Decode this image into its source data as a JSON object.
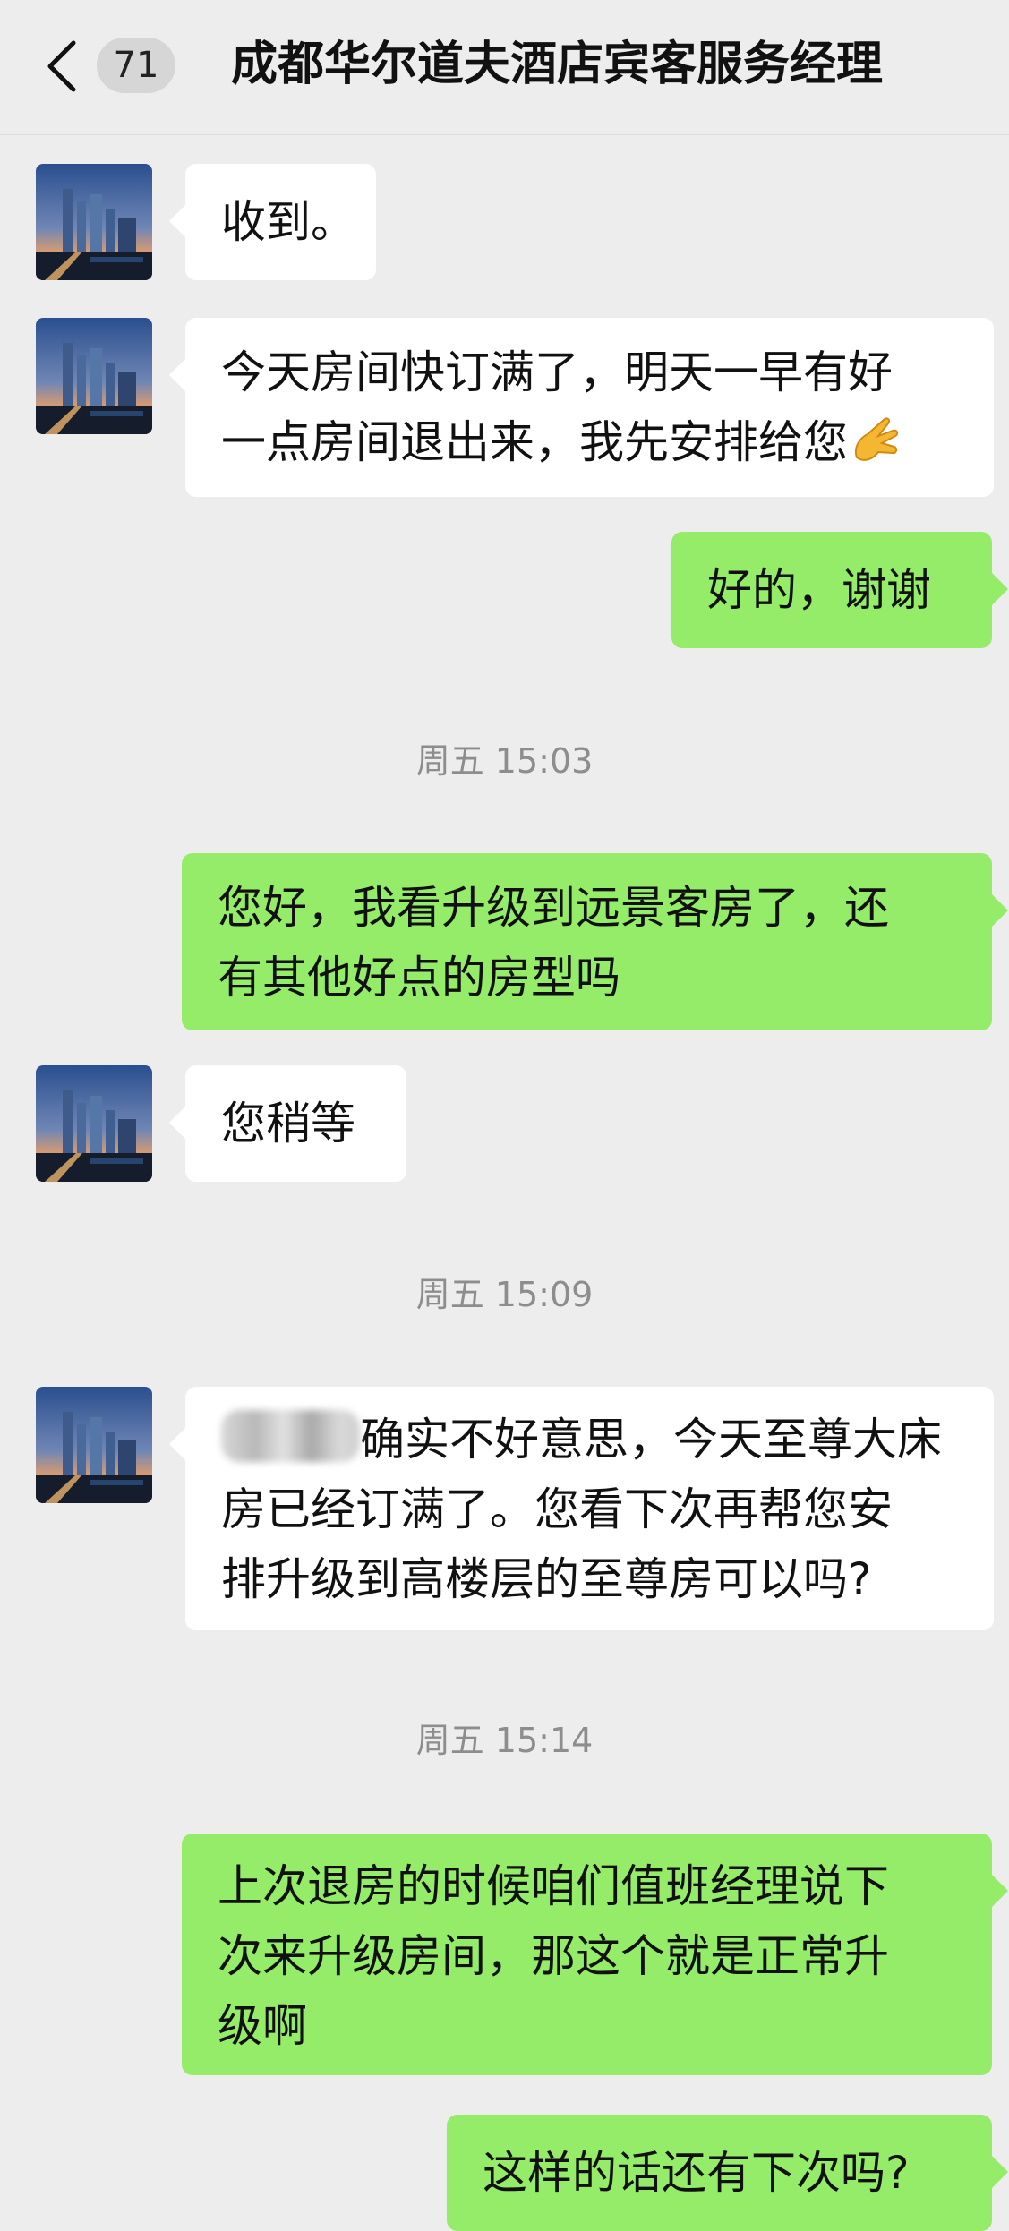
{
  "header": {
    "unread_count": "71",
    "title": "成都华尔道夫酒店宾客服务经理"
  },
  "messages": [
    {
      "side": "in",
      "lines": [
        "收到。"
      ]
    },
    {
      "side": "in",
      "lines": [
        "今天房间快订满了，明天一早有好",
        "一点房间退出来，我先安排给您"
      ],
      "emoji": "pinched-fingers-emoji"
    },
    {
      "side": "out",
      "lines": [
        "好的，谢谢"
      ]
    },
    {
      "time": "周五 15:03"
    },
    {
      "side": "out",
      "lines": [
        "您好，我看升级到远景客房了，还",
        "有其他好点的房型吗"
      ]
    },
    {
      "side": "in",
      "lines": [
        "您稍等"
      ]
    },
    {
      "time": "周五 15:09"
    },
    {
      "side": "in",
      "lines": [
        "确实不好意思，今天至尊大床",
        "房已经订满了。您看下次再帮您安",
        "排升级到高楼层的至尊房可以吗?"
      ],
      "redacted_prefix": true
    },
    {
      "time": "周五 15:14"
    },
    {
      "side": "out",
      "lines": [
        "上次退房的时候咱们值班经理说下",
        "次来升级房间，那这个就是正常升",
        "级啊"
      ]
    },
    {
      "side": "out",
      "lines": [
        "这样的话还有下次吗?"
      ]
    }
  ],
  "colors": {
    "background": "#ededed",
    "incoming_bubble": "#ffffff",
    "outgoing_bubble": "#95ec69",
    "timestamp_text": "#8d8d8d"
  },
  "icons": [
    "back-arrow-icon",
    "hotel-avatar-image",
    "pinched-fingers-emoji"
  ]
}
